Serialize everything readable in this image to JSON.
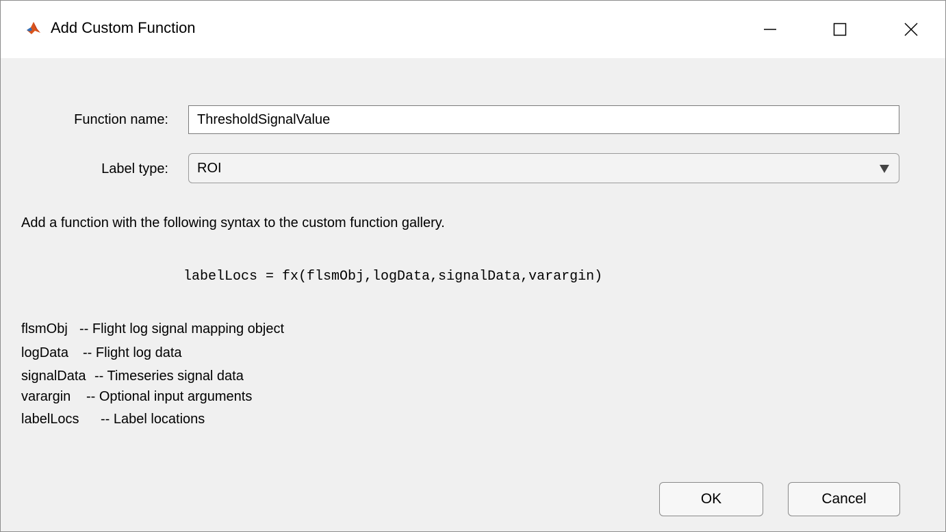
{
  "window": {
    "title": "Add Custom Function",
    "icon": "matlab-icon",
    "controls": {
      "minimize": "minimize-icon",
      "maximize": "maximize-icon",
      "close": "close-icon"
    }
  },
  "form": {
    "function_name_label": "Function name:",
    "function_name_value": "ThresholdSignalValue",
    "label_type_label": "Label type:",
    "label_type_value": "ROI"
  },
  "description": "Add a function with the following syntax to the custom function gallery.",
  "syntax": "labelLocs = fx(flsmObj,logData,signalData,varargin)",
  "arguments": [
    {
      "name": "flsmObj",
      "desc": "-- Flight log signal mapping object"
    },
    {
      "name": "logData",
      "desc": "-- Flight log data"
    },
    {
      "name": "signalData",
      "desc": "-- Timeseries signal data"
    },
    {
      "name": "varargin",
      "desc": "-- Optional input arguments"
    },
    {
      "name": "labelLocs",
      "desc": "-- Label locations"
    }
  ],
  "buttons": {
    "ok": "OK",
    "cancel": "Cancel"
  }
}
